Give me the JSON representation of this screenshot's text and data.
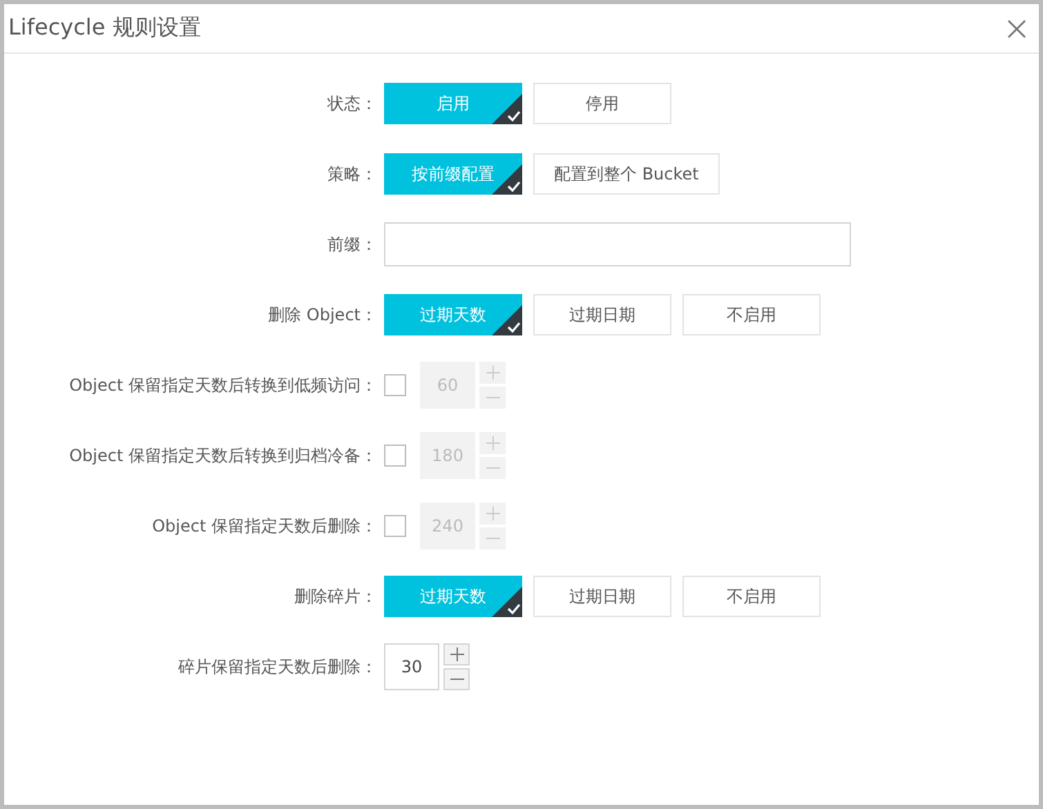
{
  "dialog": {
    "title": "Lifecycle 规则设置"
  },
  "rows": [
    {
      "kind": "choice",
      "label": "状态：",
      "options": [
        {
          "label": "启用",
          "selected": true
        },
        {
          "label": "停用",
          "selected": false
        }
      ]
    },
    {
      "kind": "choice",
      "label": "策略：",
      "options": [
        {
          "label": "按前缀配置",
          "selected": true
        },
        {
          "label": "配置到整个 Bucket",
          "selected": false
        }
      ]
    },
    {
      "kind": "text",
      "label": "前缀："
    },
    {
      "kind": "choice",
      "label": "删除 Object：",
      "options": [
        {
          "label": "过期天数",
          "selected": true
        },
        {
          "label": "过期日期",
          "selected": false
        },
        {
          "label": "不启用",
          "selected": false
        }
      ]
    },
    {
      "kind": "number",
      "label": "Object 保留指定天数后转换到低频访问：",
      "checked": false,
      "disabled": true,
      "value": "60"
    },
    {
      "kind": "number",
      "label": "Object 保留指定天数后转换到归档冷备：",
      "checked": false,
      "disabled": true,
      "value": "180"
    },
    {
      "kind": "number",
      "label": "Object 保留指定天数后删除：",
      "checked": false,
      "disabled": true,
      "value": "240"
    },
    {
      "kind": "choice",
      "label": "删除碎片：",
      "options": [
        {
          "label": "过期天数",
          "selected": true
        },
        {
          "label": "过期日期",
          "selected": false
        },
        {
          "label": "不启用",
          "selected": false
        }
      ]
    },
    {
      "kind": "number",
      "label": "碎片保留指定天数后删除：",
      "disabled": false,
      "value": "30"
    }
  ]
}
